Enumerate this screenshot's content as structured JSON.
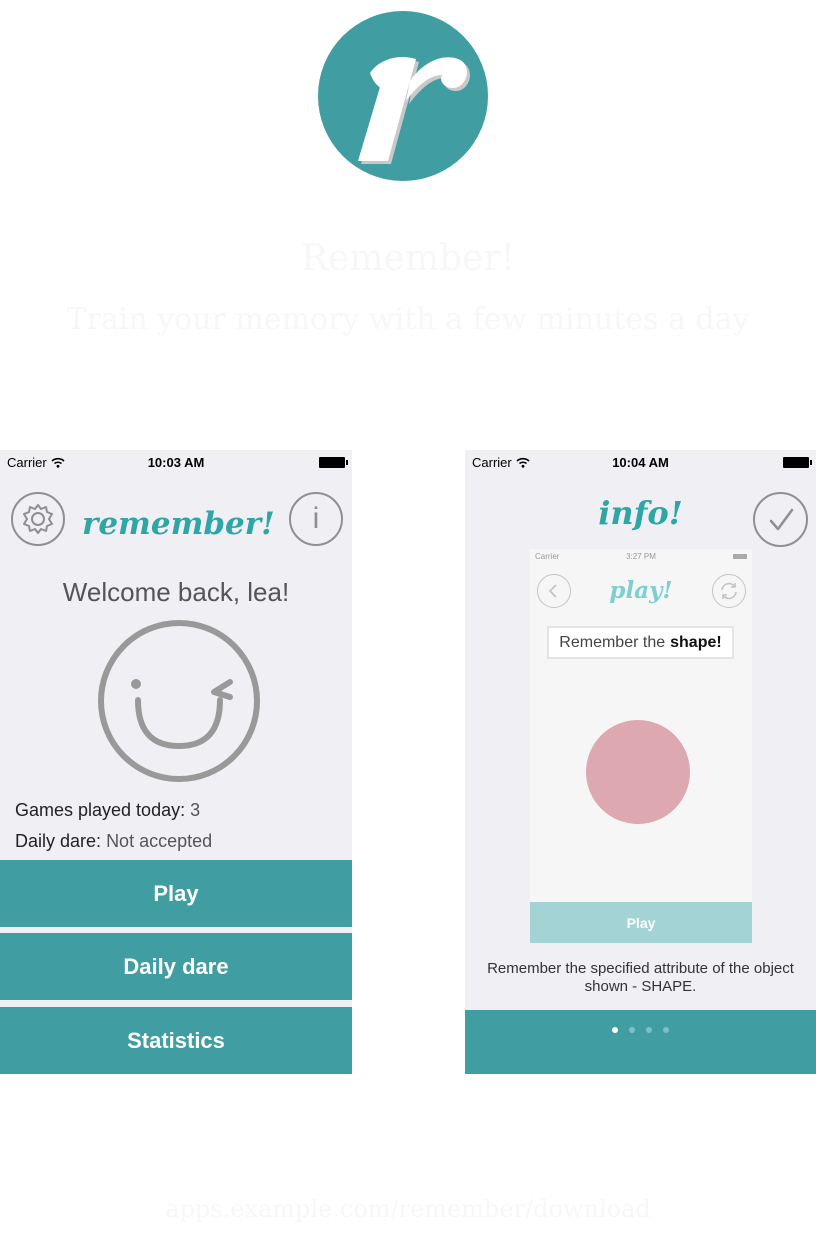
{
  "logo": {
    "letter": "r",
    "color": "#409da2"
  },
  "tagline": {
    "line1": "Remember!",
    "line2": "Train your memory with a few minutes a day",
    "url": "apps.example.com/remember/download"
  },
  "left_phone": {
    "status": {
      "carrier": "Carrier",
      "time": "10:03 AM"
    },
    "title": "remember!",
    "settings_icon": "gear-icon",
    "info_icon": "info-icon",
    "info_glyph": "i",
    "welcome": "Welcome back, lea!",
    "smiley_icon": "wink-smiley-icon",
    "stats": {
      "games_label": "Games played today:",
      "games_value": "3",
      "dare_label": "Daily dare:",
      "dare_value": "Not accepted"
    },
    "buttons": {
      "play": "Play",
      "daily_dare": "Daily dare",
      "statistics": "Statistics"
    }
  },
  "right_phone": {
    "status": {
      "carrier": "Carrier",
      "time": "10:04 AM"
    },
    "title": "info!",
    "done_icon": "checkmark-icon",
    "inner": {
      "status": {
        "carrier": "Carrier",
        "time": "3:27 PM"
      },
      "title": "play!",
      "back_icon": "chevron-left-icon",
      "refresh_icon": "refresh-icon",
      "prompt_prefix": "Remember the",
      "prompt_attribute": "shape!",
      "shape_color": "#dea8b0",
      "play_button": "Play"
    },
    "description": "Remember the specified attribute of the object shown - SHAPE.",
    "pager": {
      "total": 4,
      "current": 1
    }
  },
  "colors": {
    "accent": "#409da2",
    "title_teal": "#2ea6a6",
    "background": "#efeff4"
  }
}
